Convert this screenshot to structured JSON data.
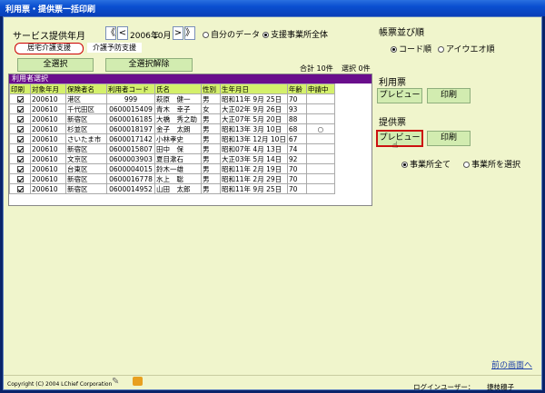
{
  "window": {
    "title": "利用票・提供票一括印刷"
  },
  "service": {
    "label": "サービス提供年月",
    "year": "2006年",
    "month": "10月",
    "nav": {
      "first": "《",
      "prev": "<",
      "next": ">",
      "last": "》"
    },
    "scope": [
      {
        "label": "自分のデータ",
        "selected": false
      },
      {
        "label": "支援事業所全体",
        "selected": true
      }
    ]
  },
  "tabs": [
    {
      "label": "居宅介護支援",
      "active": true
    },
    {
      "label": "介護予防支援",
      "active": false
    }
  ],
  "buttons": {
    "select_all": "全選択",
    "clear_all": "全選択解除"
  },
  "summary": {
    "total": "合計 10件",
    "selected": "選択 0件"
  },
  "grid": {
    "title": "利用者選択",
    "columns": [
      "印刷",
      "対象年月",
      "保険者名",
      "利用者コード",
      "氏名",
      "性別",
      "生年月日",
      "年齢",
      "申請中"
    ],
    "rows": [
      {
        "checked": true,
        "ym": "200610",
        "insurer": "港区",
        "code": "999",
        "name": "萩原　健一",
        "sex": "男",
        "birth": "昭和11年 9月 25日",
        "age": "70",
        "pending": ""
      },
      {
        "checked": true,
        "ym": "200610",
        "insurer": "千代田区",
        "code": "0600015409",
        "name": "青木　幸子",
        "sex": "女",
        "birth": "大正02年 9月 26日",
        "age": "93",
        "pending": ""
      },
      {
        "checked": true,
        "ym": "200610",
        "insurer": "新宿区",
        "code": "0600016185",
        "name": "大橋　秀之助",
        "sex": "男",
        "birth": "大正07年 5月 20日",
        "age": "88",
        "pending": ""
      },
      {
        "checked": true,
        "ym": "200610",
        "insurer": "杉並区",
        "code": "0600018197",
        "name": "金子　太朗",
        "sex": "男",
        "birth": "昭和13年 3月 10日",
        "age": "68",
        "pending": "○"
      },
      {
        "checked": true,
        "ym": "200610",
        "insurer": "さいたま市",
        "code": "0600017142",
        "name": "小林孝史",
        "sex": "男",
        "birth": "昭和13年 12月 10日",
        "age": "67",
        "pending": ""
      },
      {
        "checked": true,
        "ym": "200610",
        "insurer": "新宿区",
        "code": "0600015807",
        "name": "田中　保",
        "sex": "男",
        "birth": "昭和07年 4月 13日",
        "age": "74",
        "pending": ""
      },
      {
        "checked": true,
        "ym": "200610",
        "insurer": "文京区",
        "code": "0600003903",
        "name": "夏目漱石",
        "sex": "男",
        "birth": "大正03年 5月 14日",
        "age": "92",
        "pending": ""
      },
      {
        "checked": true,
        "ym": "200610",
        "insurer": "台東区",
        "code": "0600004015",
        "name": "鈴木一雄",
        "sex": "男",
        "birth": "昭和11年 2月 19日",
        "age": "70",
        "pending": ""
      },
      {
        "checked": true,
        "ym": "200610",
        "insurer": "新宿区",
        "code": "0600016778",
        "name": "水上　聡",
        "sex": "男",
        "birth": "昭和11年 2月 29日",
        "age": "70",
        "pending": ""
      },
      {
        "checked": true,
        "ym": "200610",
        "insurer": "新宿区",
        "code": "0600014952",
        "name": "山田　太郎",
        "sex": "男",
        "birth": "昭和11年 9月 25日",
        "age": "70",
        "pending": ""
      }
    ]
  },
  "sort": {
    "label": "帳票並び順",
    "options": [
      {
        "label": "コード順",
        "selected": true
      },
      {
        "label": "アイウエオ順",
        "selected": false
      }
    ]
  },
  "riyohyo": {
    "label": "利用票",
    "preview": "プレビュー",
    "print": "印刷"
  },
  "teikyohyo": {
    "label": "提供票",
    "preview": "プレビュー",
    "print": "印刷",
    "scope": [
      {
        "label": "事業所全て",
        "selected": true
      },
      {
        "label": "事業所を選択",
        "selected": false
      }
    ]
  },
  "back_link": "前の画面へ",
  "footer": {
    "copyright": "Copyright (C) 2004 LChief Corporation",
    "login_label": "ログインユーザー：",
    "login_user": "捷枝穗子"
  },
  "colors": {
    "bg": "#f0f5cc",
    "button": "#d2ecb0",
    "grid_title": "#6a0e8c",
    "header": "#d4f06c",
    "highlight": "#cc1111"
  }
}
